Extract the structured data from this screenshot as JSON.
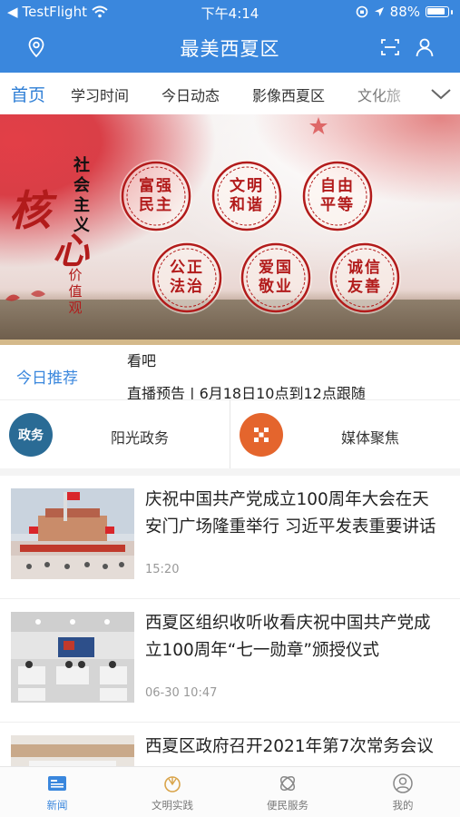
{
  "status_bar": {
    "carrier": "TestFlight",
    "time": "下午4:14",
    "battery": "88%"
  },
  "header": {
    "title": "最美西夏区",
    "icons": [
      "location-icon",
      "scan-icon",
      "user-icon"
    ]
  },
  "tabs": {
    "items": [
      "首页",
      "学习时间",
      "今日动态",
      "影像西夏区",
      "文化旅"
    ],
    "active_index": 0
  },
  "banner": {
    "calligraphy_top": "社会主义",
    "calligraphy_big1": "核",
    "calligraphy_big2": "心",
    "calligraphy_bottom": "价值观",
    "seals": [
      "富强民主",
      "文明和谐",
      "自由平等",
      "公正法治",
      "爱国敬业",
      "诚信友善"
    ]
  },
  "recommend": {
    "label": "今日推荐",
    "line1": "看吧",
    "line2": "直播预告 | 6月18日10点到12点跟随"
  },
  "quick_links": [
    {
      "icon_text": "政务",
      "label": "阳光政务"
    },
    {
      "icon_text": "",
      "label": "媒体聚焦"
    }
  ],
  "news": [
    {
      "title": "庆祝中国共产党成立100周年大会在天安门广场隆重举行 习近平发表重要讲话",
      "time": "15:20"
    },
    {
      "title": "西夏区组织收听收看庆祝中国共产党成立100周年“七一勋章”颁授仪式",
      "time": "06-30 10:47"
    },
    {
      "title": "西夏区政府召开2021年第7次常务会议",
      "time": ""
    }
  ],
  "bottom_nav": {
    "items": [
      "新闻",
      "文明实践",
      "便民服务",
      "我的"
    ],
    "active_index": 0
  },
  "colors": {
    "brand_blue": "#3a87dd",
    "gov_icon": "#2a6b95",
    "media_icon": "#e4652d",
    "seal_red": "#b21b1b"
  }
}
